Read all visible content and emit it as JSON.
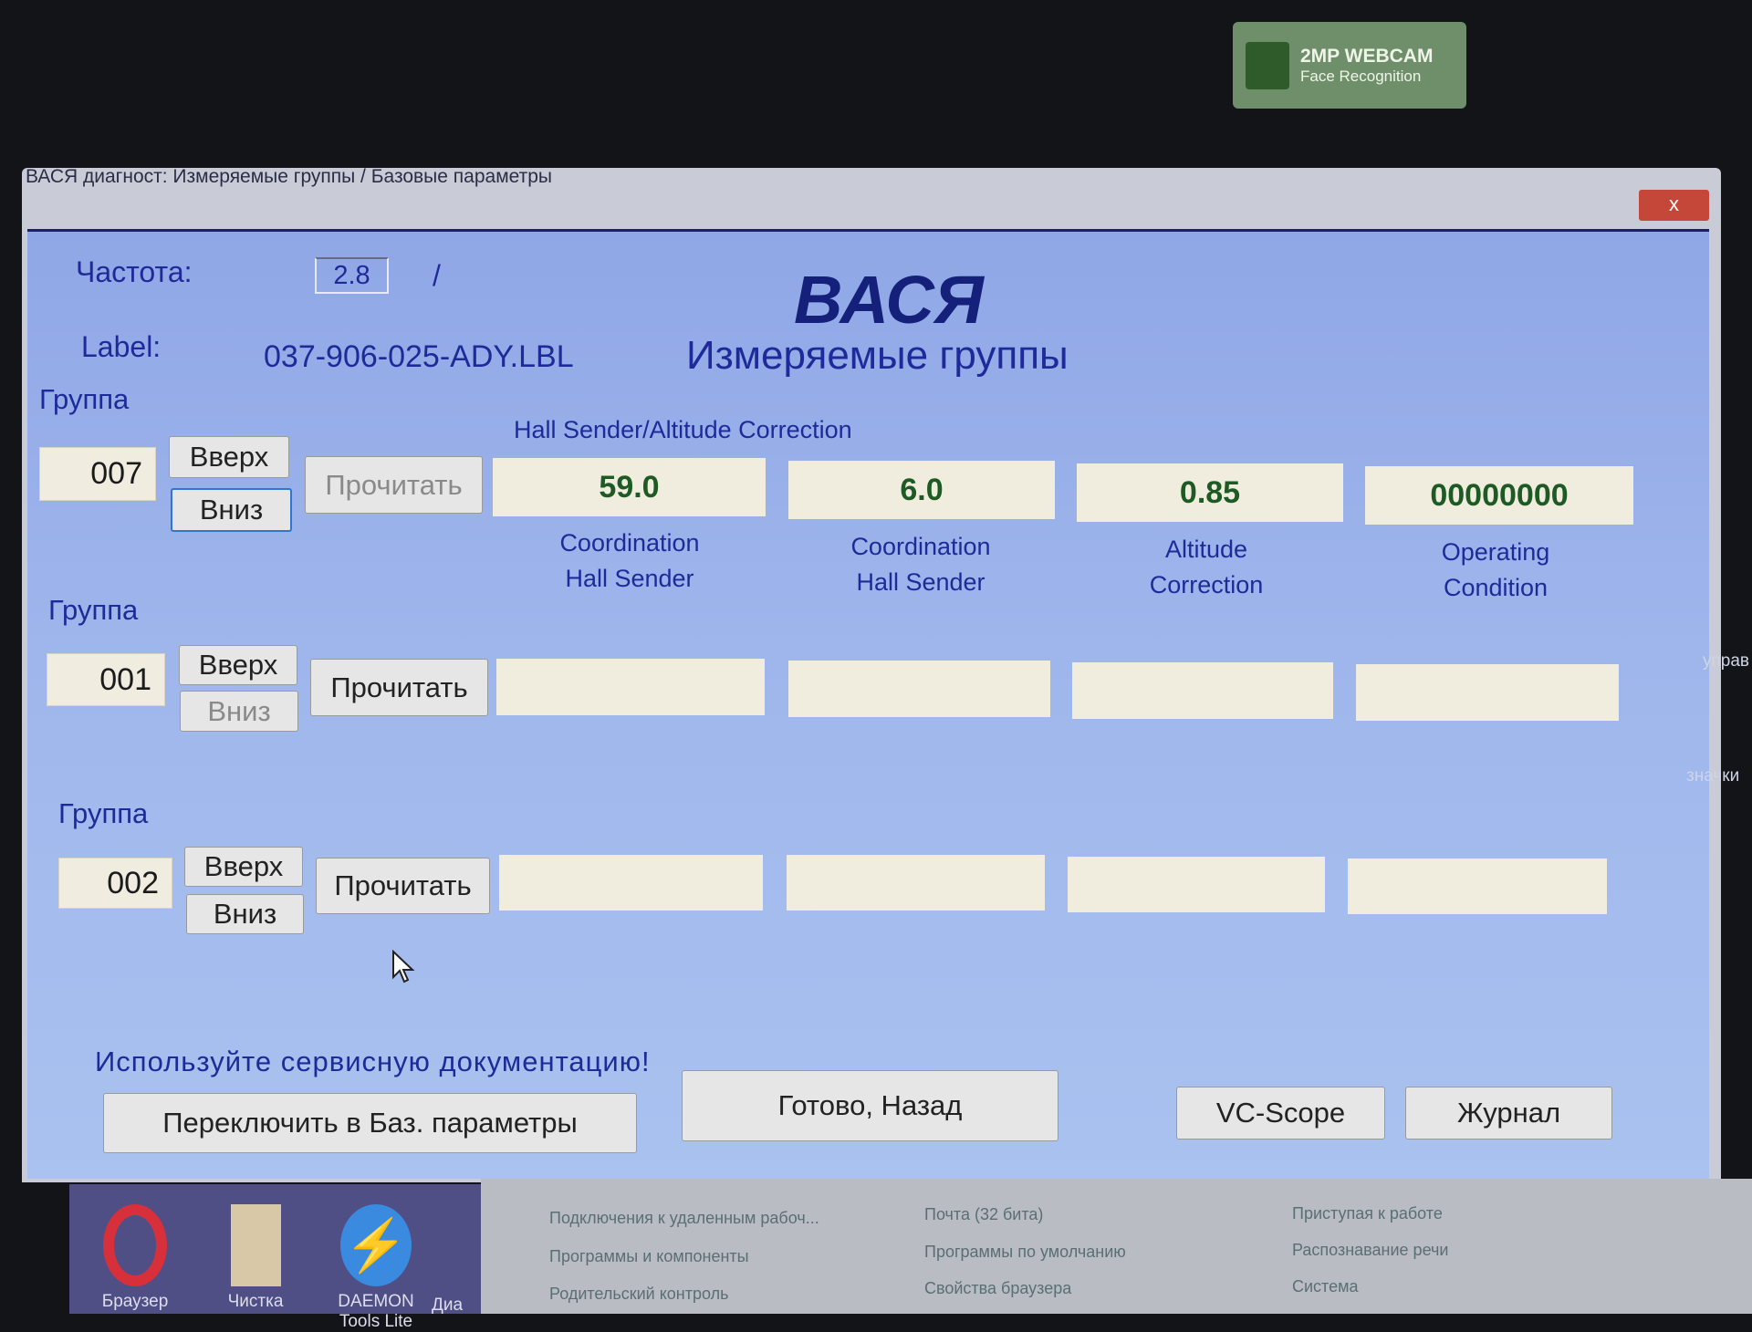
{
  "webcam": {
    "title": "2MP WEBCAM",
    "subtitle": "Face Recognition"
  },
  "window": {
    "title": "ВАСЯ диагност: Измеряемые группы / Базовые параметры",
    "close": "x"
  },
  "header": {
    "freq_label": "Частота:",
    "freq_value": "2.8",
    "freq_sep": "/",
    "label_label": "Label:",
    "label_value": "037-906-025-ADY.LBL",
    "app_name": "ВАСЯ",
    "subtitle": "Измеряемые группы"
  },
  "groups": [
    {
      "caption": "Группа",
      "number": "007",
      "up": "Вверх",
      "down": "Вниз",
      "read": "Прочитать",
      "header": "Hall Sender/Altitude Correction",
      "values": [
        "59.0",
        "6.0",
        "0.85",
        "00000000"
      ],
      "labels": [
        [
          "Coordination",
          "Hall Sender"
        ],
        [
          "Coordination",
          "Hall Sender"
        ],
        [
          "Altitude",
          "Correction"
        ],
        [
          "Operating",
          "Condition"
        ]
      ]
    },
    {
      "caption": "Группа",
      "number": "001",
      "up": "Вверх",
      "down": "Вниз",
      "read": "Прочитать",
      "values": [
        "",
        "",
        "",
        ""
      ]
    },
    {
      "caption": "Группа",
      "number": "002",
      "up": "Вверх",
      "down": "Вниз",
      "read": "Прочитать",
      "values": [
        "",
        "",
        "",
        ""
      ]
    }
  ],
  "footer": {
    "warning": "Используйте сервисную документацию!",
    "switch": "Переключить в Баз. параметры",
    "done": "Готово, Назад",
    "vcscope": "VC-Scope",
    "log": "Журнал"
  },
  "desktop": {
    "icons": [
      "Браузер",
      "Чистка",
      "DAEMON Tools Lite",
      "Диа"
    ],
    "control_panel": [
      "Подключения к удаленным рабоч...",
      "Программы и компоненты",
      "Родительский контроль",
      "Почта (32 бита)",
      "Программы по умолчанию",
      "Свойства браузера",
      "Приступая к работе",
      "Распознавание речи",
      "Система"
    ],
    "fragments": [
      "управ",
      "значки"
    ]
  },
  "colors": {
    "client_bg": "#9fb6ec",
    "text": "#1f2a9a",
    "value_text": "#1d5a24",
    "field_bg": "#f0ecde"
  }
}
